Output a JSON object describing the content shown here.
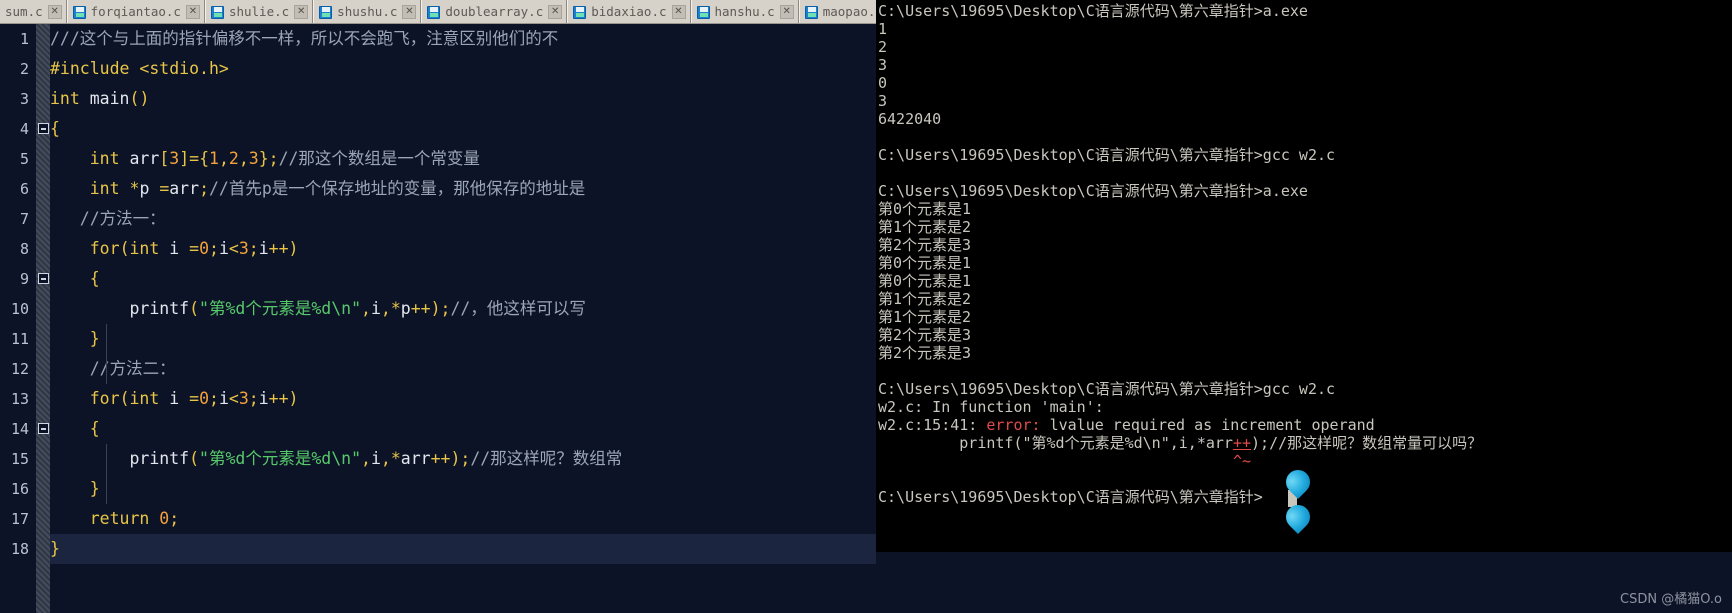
{
  "tabs": [
    {
      "label": "sum.c",
      "has_icon": false
    },
    {
      "label": "forqiantao.c",
      "has_icon": true
    },
    {
      "label": "shulie.c",
      "has_icon": true
    },
    {
      "label": "shushu.c",
      "has_icon": true
    },
    {
      "label": "doublearray.c",
      "has_icon": true
    },
    {
      "label": "bidaxiao.c",
      "has_icon": true
    },
    {
      "label": "hanshu.c",
      "has_icon": true
    },
    {
      "label": "maopao.c",
      "has_icon": true
    }
  ],
  "tab_close_glyph": "✕",
  "editor": {
    "line_numbers": [
      "1",
      "2",
      "3",
      "4",
      "5",
      "6",
      "7",
      "8",
      "9",
      "10",
      "11",
      "12",
      "13",
      "14",
      "15",
      "16",
      "17",
      "18"
    ],
    "lines": [
      "///这个与上面的指针偏移不一样，所以不会跑飞，注意区别他们的不",
      "#include <stdio.h>",
      "int main()",
      "{",
      "    int arr[3]={1,2,3};//那这个数组是一个常变量",
      "    int *p =arr;//首先p是一个保存地址的变量，那他保存的地址是",
      "   //方法一：",
      "    for(int i =0;i<3;i++)",
      "    {",
      "        printf(\"第%d个元素是%d\\n\",i,*p++);//，他这样可以写",
      "    }",
      "    //方法二：",
      "    for(int i =0;i<3;i++)",
      "    {",
      "        printf(\"第%d个元素是%d\\n\",i,*arr++);//那这样呢？数组常",
      "    }",
      "    return 0;",
      "}"
    ],
    "highlighted_line": 18,
    "fold_lines": [
      4,
      9,
      14
    ]
  },
  "terminal": {
    "prompt": "C:\\Users\\19695\\Desktop\\C语言源代码\\第六章指针>",
    "lines": [
      "C:\\Users\\19695\\Desktop\\C语言源代码\\第六章指针>a.exe",
      "1",
      "2",
      "3",
      "0",
      "3",
      "6422040",
      "",
      "C:\\Users\\19695\\Desktop\\C语言源代码\\第六章指针>gcc w2.c",
      "",
      "C:\\Users\\19695\\Desktop\\C语言源代码\\第六章指针>a.exe",
      "第0个元素是1",
      "第1个元素是2",
      "第2个元素是3",
      "第0个元素是1",
      "第0个元素是1",
      "第1个元素是2",
      "第1个元素是2",
      "第2个元素是3",
      "第2个元素是3",
      "",
      "C:\\Users\\19695\\Desktop\\C语言源代码\\第六章指针>gcc w2.c"
    ],
    "error_block": {
      "function_line": "w2.c: In function 'main':",
      "location": "w2.c:15:41: ",
      "error_label": "error:",
      "error_message": " lvalue required as increment operand",
      "source_line_prefix": "         printf(\"第%d个元素是%d\\n\",i,*arr",
      "source_line_increment": "++",
      "source_line_suffix": ");//那这样呢？数组常量可以吗？",
      "caret_marker": "^~"
    },
    "final_prompt": "C:\\Users\\19695\\Desktop\\C语言源代码\\第六章指针>"
  },
  "watermark": "CSDN @橘猫O.o",
  "colors": {
    "editor_bg": "#0d1326",
    "terminal_bg": "#000000",
    "tabbar_bg": "#d6d2ca",
    "keyword": "#e8c547",
    "string": "#57c96b",
    "comment": "#9aa5b5",
    "number": "#f2a33c",
    "error": "#e04a4a",
    "orb": "#1fa8dd"
  }
}
